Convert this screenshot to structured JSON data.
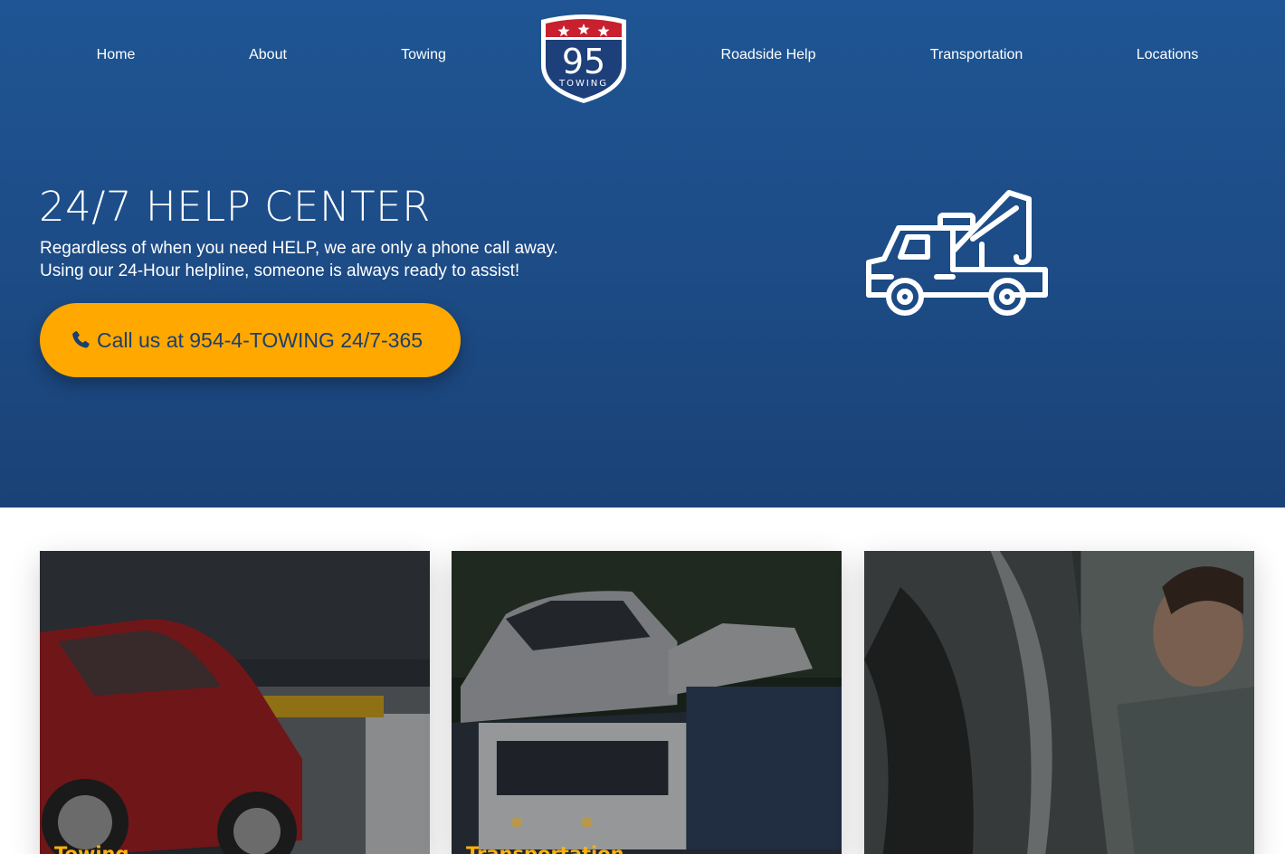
{
  "nav": {
    "items": [
      {
        "label": "Home"
      },
      {
        "label": "About"
      },
      {
        "label": "Towing"
      },
      {
        "label": "Roadside Help"
      },
      {
        "label": "Transportation"
      },
      {
        "label": "Locations"
      }
    ],
    "logo": {
      "number": "95",
      "word": "TOWING",
      "icon": "interstate-shield-logo"
    }
  },
  "hero": {
    "title": "24/7 HELP CENTER",
    "subtitle_line1": "Regardless of when you need HELP, we are only a phone call away.",
    "subtitle_line2": "Using our 24-Hour helpline, someone is always ready to assist!",
    "cta_label": "Call us at 954-4-TOWING 24/7-365",
    "cta_icon": "phone-icon",
    "illustration_icon": "tow-truck-icon"
  },
  "cards": [
    {
      "title": "Towing",
      "image": "red-car-on-tow-truck"
    },
    {
      "title": "Transportation",
      "image": "car-carrier-truck"
    },
    {
      "title": "",
      "image": "man-checking-tire"
    }
  ],
  "colors": {
    "hero_bg": "#1f5594",
    "accent": "#ffa800",
    "cta_text": "#1b3f6e",
    "card_title": "#ffb10a",
    "shield_red": "#c8202e",
    "shield_blue": "#1d3f7a"
  }
}
